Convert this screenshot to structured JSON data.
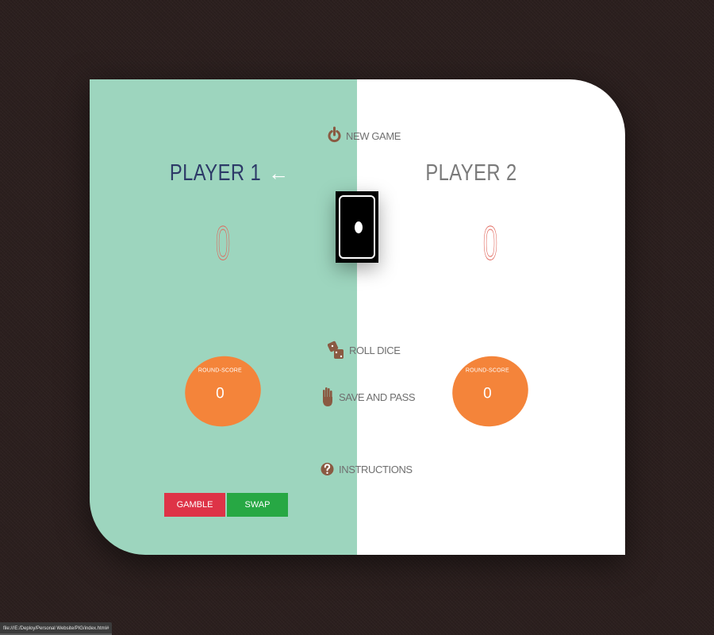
{
  "players": [
    {
      "name": "PLAYER 1",
      "score": "0",
      "round_label": "ROUND-SCORE",
      "round_score": "0",
      "active": true
    },
    {
      "name": "PLAYER 2",
      "score": "0",
      "round_label": "ROUND-SCORE",
      "round_score": "0",
      "active": false
    }
  ],
  "controls": {
    "new_game": "NEW GAME",
    "roll_dice": "ROLL DICE",
    "save_and_pass": "SAVE AND PASS",
    "instructions": "INSTRUCTIONS"
  },
  "buttons": {
    "gamble": "GAMBLE",
    "swap": "SWAP"
  },
  "active_indicator": "←",
  "dice_value": 1,
  "status_url": "file:///E:/Deploy/Personal Website/PIG/index.html#",
  "colors": {
    "player1_bg": "#9dd5be",
    "player2_bg": "#ffffff",
    "round_score_bg": "#f4843a",
    "score_stroke": "#e0655a",
    "gamble": "#de3347",
    "swap": "#27a844",
    "icon": "#8a5a42"
  },
  "icons": {
    "new_game": "power-icon",
    "roll_dice": "dice-icon",
    "save_and_pass": "hand-icon",
    "instructions": "question-icon"
  }
}
